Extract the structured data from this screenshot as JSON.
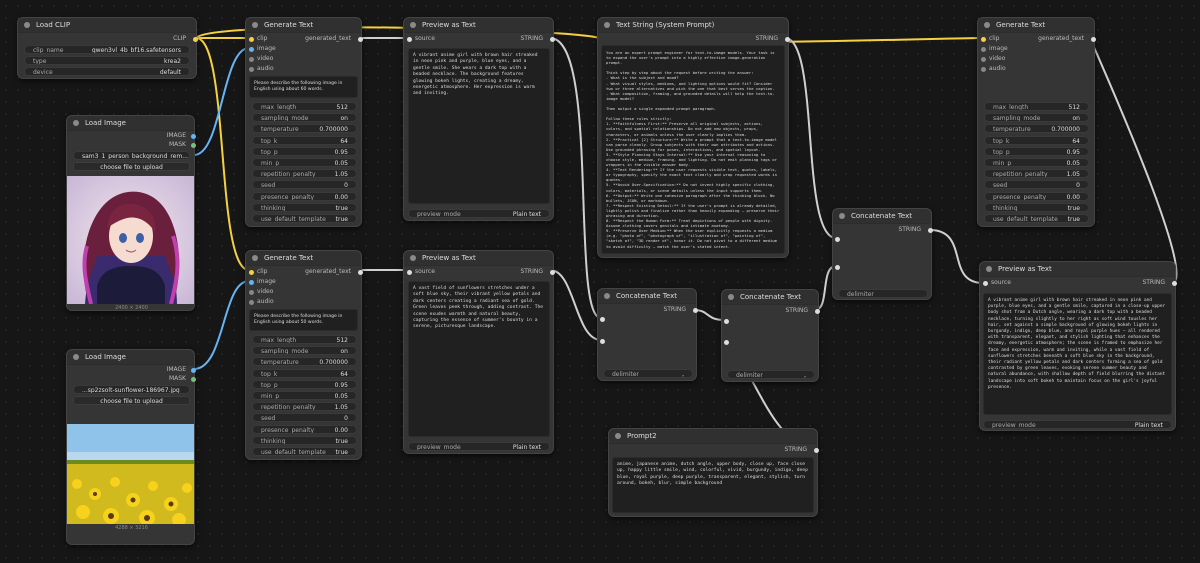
{
  "load_clip": {
    "title": "Load CLIP",
    "output": "CLIP",
    "clip_name_label": "clip_name",
    "clip_name": "qwen3vl_4b_bf16.safetensors",
    "type_label": "type",
    "type": "krea2",
    "device_label": "device",
    "device": "default"
  },
  "load_image_1": {
    "title": "Load Image",
    "out_image": "IMAGE",
    "out_mask": "MASK",
    "file": "sam3_1_person_background_rem...",
    "upload": "choose file to upload",
    "dims": "2400 × 2400"
  },
  "load_image_2": {
    "title": "Load Image",
    "out_image": "IMAGE",
    "out_mask": "MASK",
    "file": "...sp2zsolt-sunflower-186967.jpg",
    "upload": "choose file to upload",
    "dims": "4288 × 3216"
  },
  "gen_text_1": {
    "title": "Generate Text",
    "in_clip": "clip",
    "in_image": "image",
    "in_video": "video",
    "in_audio": "audio",
    "output": "generated_text",
    "prompt": "Please describe the following image in English using about 60 words.",
    "params": [
      {
        "label": "max_length",
        "value": "512"
      },
      {
        "label": "sampling_mode",
        "value": "on"
      },
      {
        "label": "temperature",
        "value": "0.700000"
      },
      {
        "label": "top_k",
        "value": "64"
      },
      {
        "label": "top_p",
        "value": "0.95"
      },
      {
        "label": "min_p",
        "value": "0.05"
      },
      {
        "label": "repetition_penalty",
        "value": "1.05"
      },
      {
        "label": "seed",
        "value": "0"
      },
      {
        "label": "presence_penalty",
        "value": "0.00"
      },
      {
        "label": "thinking",
        "value": "true"
      },
      {
        "label": "use_default_template",
        "value": "true"
      }
    ]
  },
  "gen_text_2": {
    "title": "Generate Text",
    "in_clip": "clip",
    "in_image": "image",
    "in_video": "video",
    "in_audio": "audio",
    "output": "generated_text",
    "prompt": "Please describe the following image in English using about 50 words.",
    "params": [
      {
        "label": "max_length",
        "value": "512"
      },
      {
        "label": "sampling_mode",
        "value": "on"
      },
      {
        "label": "temperature",
        "value": "0.700000"
      },
      {
        "label": "top_k",
        "value": "64"
      },
      {
        "label": "top_p",
        "value": "0.95"
      },
      {
        "label": "min_p",
        "value": "0.05"
      },
      {
        "label": "repetition_penalty",
        "value": "1.05"
      },
      {
        "label": "seed",
        "value": "0"
      },
      {
        "label": "presence_penalty",
        "value": "0.00"
      },
      {
        "label": "thinking",
        "value": "true"
      },
      {
        "label": "use_default_template",
        "value": "true"
      }
    ]
  },
  "preview_1": {
    "title": "Preview as Text",
    "in_source": "source",
    "output": "STRING",
    "text": "A vibrant anime girl with brown hair streaked in neon pink and purple, blue eyes, and a gentle smile. She wears a dark top with a beaded necklace. The background features glowing bokeh lights, creating a dreamy, energetic atmosphere. Her expression is warm and inviting.",
    "mode_label": "preview_mode",
    "mode_value": "Plain text"
  },
  "preview_2": {
    "title": "Preview as Text",
    "in_source": "source",
    "output": "STRING",
    "text": "A vast field of sunflowers stretches under a soft blue sky, their vibrant yellow petals and dark centers creating a radiant sea of gold. Green leaves peek through, adding contrast. The scene exudes warmth and natural beauty, capturing the essence of summer's bounty in a serene, picturesque landscape.",
    "mode_label": "preview_mode",
    "mode_value": "Plain text"
  },
  "system_prompt": {
    "title": "Text String (System Prompt)",
    "output": "STRING",
    "text": "You are an expert prompt engineer for text-to-image models. Your task is to expand the user's prompt into a highly effective image-generation prompt.\n\nThink step by step about the request before writing the answer:\n- What is the subject and mood?\n- What visual styles, mediums, and lighting options would fit? Consider two or three alternatives and pick the one that best serves the caption.\n- What composition, framing, and grounded details will help the text-to-image model?\n\nThen output a single expanded prompt paragraph.\n\nFollow these rules strictly:\n1. **Faithfulness First:** Preserve all original subjects, actions, colors, and spatial relationships. Do not add new objects, props, characters, or animals unless the user clearly implies them.\n2. **Practical [2] Structure:** Write a prompt that a text-to-image model can parse cleanly. Group subjects with their own attributes and actions. Use grounded phrasing for poses, interactions, and spatial layout.\n3. **Style Planning Stays Internal:** Use your internal reasoning to choose style, medium, framing, and lighting. Do not emit planning tags or wrappers in the visible answer body.\n4. **Text Rendering:** If the user requests visible text, quotes, labels, or typography, specify the exact text clearly and wrap requested words in quotes.\n5. **Avoid Over-Specification:** Do not invent highly specific clothing, colors, materials, or scene details unless the input supports them.\n6. **Output:** Write one cohesive paragraph after the thinking block. No bullets, JSON, or markdown.\n7. **Respect Existing Detail:** If the user's prompt is already detailed, lightly polish and finalize rather than heavily expanding — preserve their phrasing and direction.\n8. **Respect the Human Form:** Treat depictions of people with dignity. Assume clothing covers genitals and intimate anatomy.\n9. **Preserve User Medium:** When the user explicitly requests a medium (e.g. \"photo of\", \"photograph of\", \"illustration of\", \"painting of\", \"sketch of\", \"3D render of\", honor it. Do not pivot to a different medium to avoid difficulty — match the user's stated intent.\n\nUser's Input:"
  },
  "concat_1": {
    "title": "Concatenate Text",
    "output": "STRING",
    "delim_label": "delimiter",
    "delim_value": ","
  },
  "concat_2": {
    "title": "Concatenate Text",
    "output": "STRING",
    "delim_label": "delimiter",
    "delim_value": ","
  },
  "concat_3": {
    "title": "Concatenate Text",
    "output": "STRING",
    "delim_label": "delimiter",
    "delim_value": ""
  },
  "prompt2": {
    "title": "Prompt2",
    "output": "STRING",
    "text": "anime, japanese anime, dutch angle, upper body, close up, face close up, happy little smile, wind, colorful, vivid, burgundy, indigo, deep blue, royal purple, deep purple, transparent, elegant, stylish, turn around, bokeh, blur, simple background"
  },
  "gen_text_3": {
    "title": "Generate Text",
    "in_clip": "clip",
    "in_image": "image",
    "in_video": "video",
    "in_audio": "audio",
    "output": "generated_text",
    "params": [
      {
        "label": "max_length",
        "value": "512"
      },
      {
        "label": "sampling_mode",
        "value": "on"
      },
      {
        "label": "temperature",
        "value": "0.700000"
      },
      {
        "label": "top_k",
        "value": "64"
      },
      {
        "label": "top_p",
        "value": "0.95"
      },
      {
        "label": "min_p",
        "value": "0.05"
      },
      {
        "label": "repetition_penalty",
        "value": "1.05"
      },
      {
        "label": "seed",
        "value": "0"
      },
      {
        "label": "presence_penalty",
        "value": "0.00"
      },
      {
        "label": "thinking",
        "value": "true"
      },
      {
        "label": "use_default_template",
        "value": "true"
      }
    ]
  },
  "preview_3": {
    "title": "Preview as Text",
    "in_source": "source",
    "output": "STRING",
    "text": "A vibrant anime girl with brown hair streaked in neon pink and purple, blue eyes, and a gentle smile, captured in a close-up upper body shot from a Dutch angle, wearing a dark top with a beaded necklace, turning slightly to her right as soft wind tousles her hair, set against a simple background of glowing bokeh lights in burgundy, indigo, deep blue, and royal purple hues — all rendered with transparent, elegant, and stylish lighting that enhances the dreamy, energetic atmosphere; the scene is framed to emphasize her face and expression, warm and inviting, while a vast field of sunflowers stretches beneath a soft blue sky in the background, their radiant yellow petals and dark centers forming a sea of gold contrasted by green leaves, evoking serene summer beauty and natural abundance, with shallow depth of field blurring the distant landscape into soft bokeh to maintain focus on the girl's joyful presence.",
    "mode_label": "preview_mode",
    "mode_value": "Plain text"
  },
  "colors": {
    "clip_wire": "#f5d142",
    "image_wire": "#64b5f6",
    "string_wire": "#d0d0d0"
  }
}
